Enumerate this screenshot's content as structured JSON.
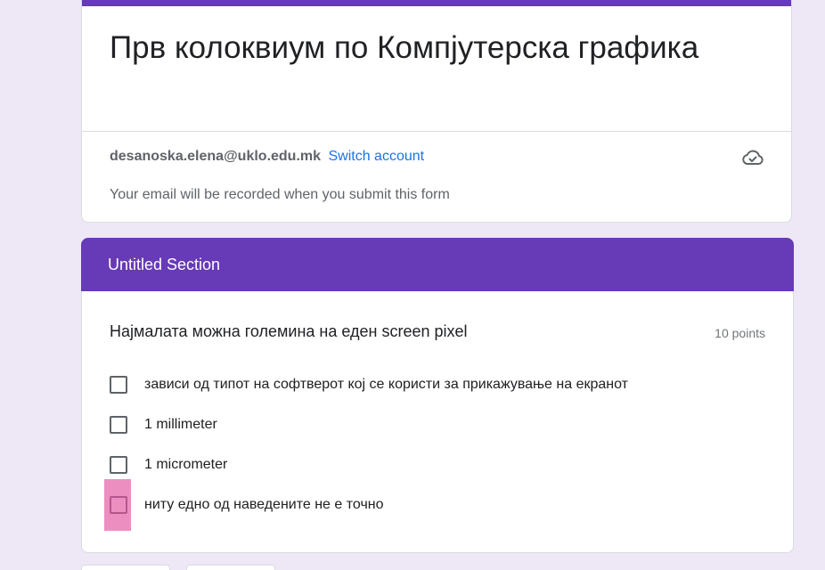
{
  "form": {
    "title": "Прв колоквиум по Компјутерска графика",
    "account_email": "desanoska.elena@uklo.edu.mk",
    "switch_account": "Switch account",
    "record_notice": "Your email will be recorded when you submit this form"
  },
  "section": {
    "title": "Untitled Section"
  },
  "question": {
    "title": "Најмалата можна големина на еден screen pixel",
    "points": "10 points",
    "options": [
      {
        "label": "зависи од типот на софтверот кој се користи за прикажување на екранот",
        "checked": false
      },
      {
        "label": "1 millimeter",
        "checked": false
      },
      {
        "label": "1 micrometer",
        "checked": false
      },
      {
        "label": "ниту едно од наведените не е точно",
        "checked": false
      }
    ]
  },
  "icons": {
    "cloud": "cloud-saved-icon"
  },
  "colors": {
    "accent": "#673ab7",
    "background": "#ede7f6",
    "link": "#1a73e8",
    "highlight": "#e352a0"
  }
}
